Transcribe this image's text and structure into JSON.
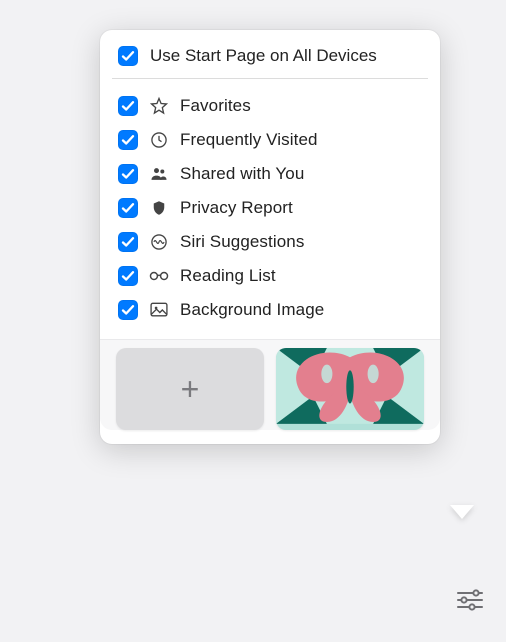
{
  "popover": {
    "header": {
      "label": "Use Start Page on All Devices",
      "checked": true
    },
    "items": [
      {
        "icon": "star-icon",
        "label": "Favorites",
        "checked": true
      },
      {
        "icon": "clock-icon",
        "label": "Frequently Visited",
        "checked": true
      },
      {
        "icon": "people-icon",
        "label": "Shared with You",
        "checked": true
      },
      {
        "icon": "shield-icon",
        "label": "Privacy Report",
        "checked": true
      },
      {
        "icon": "siri-icon",
        "label": "Siri Suggestions",
        "checked": true
      },
      {
        "icon": "glasses-icon",
        "label": "Reading List",
        "checked": true
      },
      {
        "icon": "image-icon",
        "label": "Background Image",
        "checked": true
      }
    ],
    "tiles": {
      "add_label": "+",
      "preview_colors": {
        "bg": "#bfe8e0",
        "wing": "#e37f8e",
        "body": "#0f6b5e"
      }
    }
  },
  "toolbar": {
    "settings_icon": "sliders-icon"
  }
}
